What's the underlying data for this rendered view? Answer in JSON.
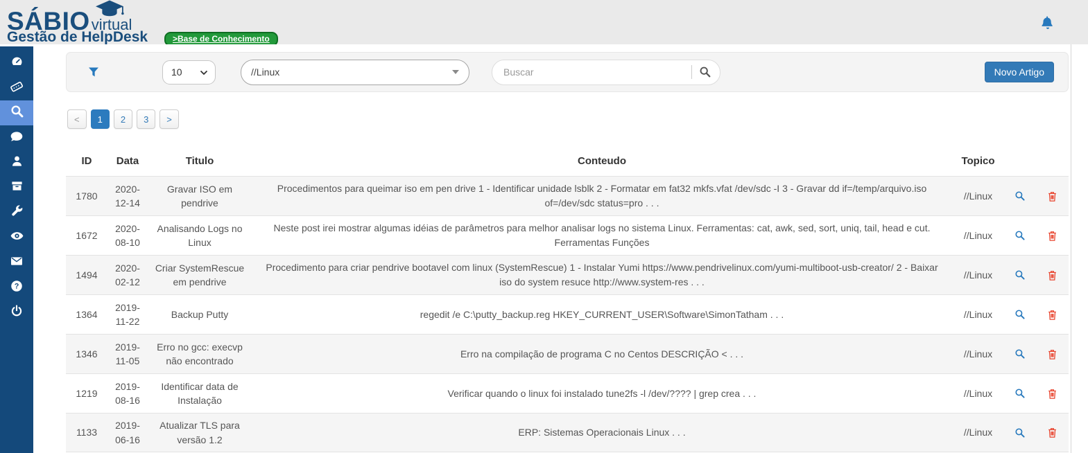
{
  "header": {
    "logo": {
      "title": "SÁBIO",
      "suffix": "virtual",
      "tagline": "Gestão de HelpDesk"
    },
    "badge_label": ">Base de Conhecimento"
  },
  "sidebar": {
    "items": [
      {
        "name": "dashboard"
      },
      {
        "name": "tickets"
      },
      {
        "name": "search-knowledge-base",
        "active": true
      },
      {
        "name": "comments"
      },
      {
        "name": "users"
      },
      {
        "name": "archive"
      },
      {
        "name": "tools"
      },
      {
        "name": "monitor"
      },
      {
        "name": "mail"
      },
      {
        "name": "help"
      },
      {
        "name": "logout"
      }
    ]
  },
  "toolbar": {
    "page_size": "10",
    "topic_filter": "//Linux",
    "search_placeholder": "Buscar",
    "new_article_label": "Novo Artigo"
  },
  "pagination": {
    "prev": "<",
    "pages": [
      "1",
      "2",
      "3"
    ],
    "active_page": "1",
    "next": ">"
  },
  "table": {
    "columns": [
      "ID",
      "Data",
      "Titulo",
      "Conteudo",
      "Topico"
    ],
    "rows": [
      {
        "id": "1780",
        "data": "2020-12-14",
        "titulo": "Gravar ISO em pendrive",
        "conteudo": "Procedimentos  para queimar iso em pen drive 1 - Identificar unidade lsblk 2 - Formatar em fat32 mkfs.vfat  /dev/sdc -I 3 - Gravar dd if=/temp/arquivo.iso of=/dev/sdc status=pro . . .",
        "topico": "//Linux"
      },
      {
        "id": "1672",
        "data": "2020-08-10",
        "titulo": "Analisando Logs no Linux",
        "conteudo": "Neste post irei mostrar algumas idéias de parâmetros para melhor analisar logs no sistema Linux. Ferramentas: cat, awk, sed, sort, uniq, tail, head e cut. Ferramentas Funções",
        "topico": "//Linux"
      },
      {
        "id": "1494",
        "data": "2020-02-12",
        "titulo": "Criar SystemRescue em pendrive",
        "conteudo": "Procedimento para criar pendrive bootavel com linux (SystemRescue) 1 - Instalar Yumi https://www.pendrivelinux.com/yumi-multiboot-usb-creator/ 2 - Baixar iso do system resuce http://www.system-res . . .",
        "topico": "//Linux"
      },
      {
        "id": "1364",
        "data": "2019-11-22",
        "titulo": "Backup Putty",
        "conteudo": "regedit /e C:\\putty_backup.reg HKEY_CURRENT_USER\\Software\\SimonTatham . . .",
        "topico": "//Linux"
      },
      {
        "id": "1346",
        "data": "2019-11-05",
        "titulo": "Erro no gcc: execvp não encontrado",
        "conteudo": "Erro na compilação de programa C no Centos   DESCRIÇÃO < . . .",
        "topico": "//Linux"
      },
      {
        "id": "1219",
        "data": "2019-08-16",
        "titulo": "Identificar data de Instalação",
        "conteudo": "Verificar quando o linux foi instalado tune2fs -l /dev/????   |   grep crea . . .",
        "topico": "//Linux"
      },
      {
        "id": "1133",
        "data": "2019-06-16",
        "titulo": "Atualizar TLS para versão 1.2",
        "conteudo": "ERP: Sistemas Operacionais Linux . . .",
        "topico": "//Linux"
      }
    ]
  },
  "colors": {
    "sidebar": "#14497B",
    "sidebar_active": "#6191DC",
    "brand_text": "#1A4E7D",
    "badge_green": "#22993A",
    "accent_blue": "#337AB7",
    "icon_blue": "#2779BD",
    "danger_red": "#E8432D",
    "header_gray": "#EAEAEA"
  }
}
